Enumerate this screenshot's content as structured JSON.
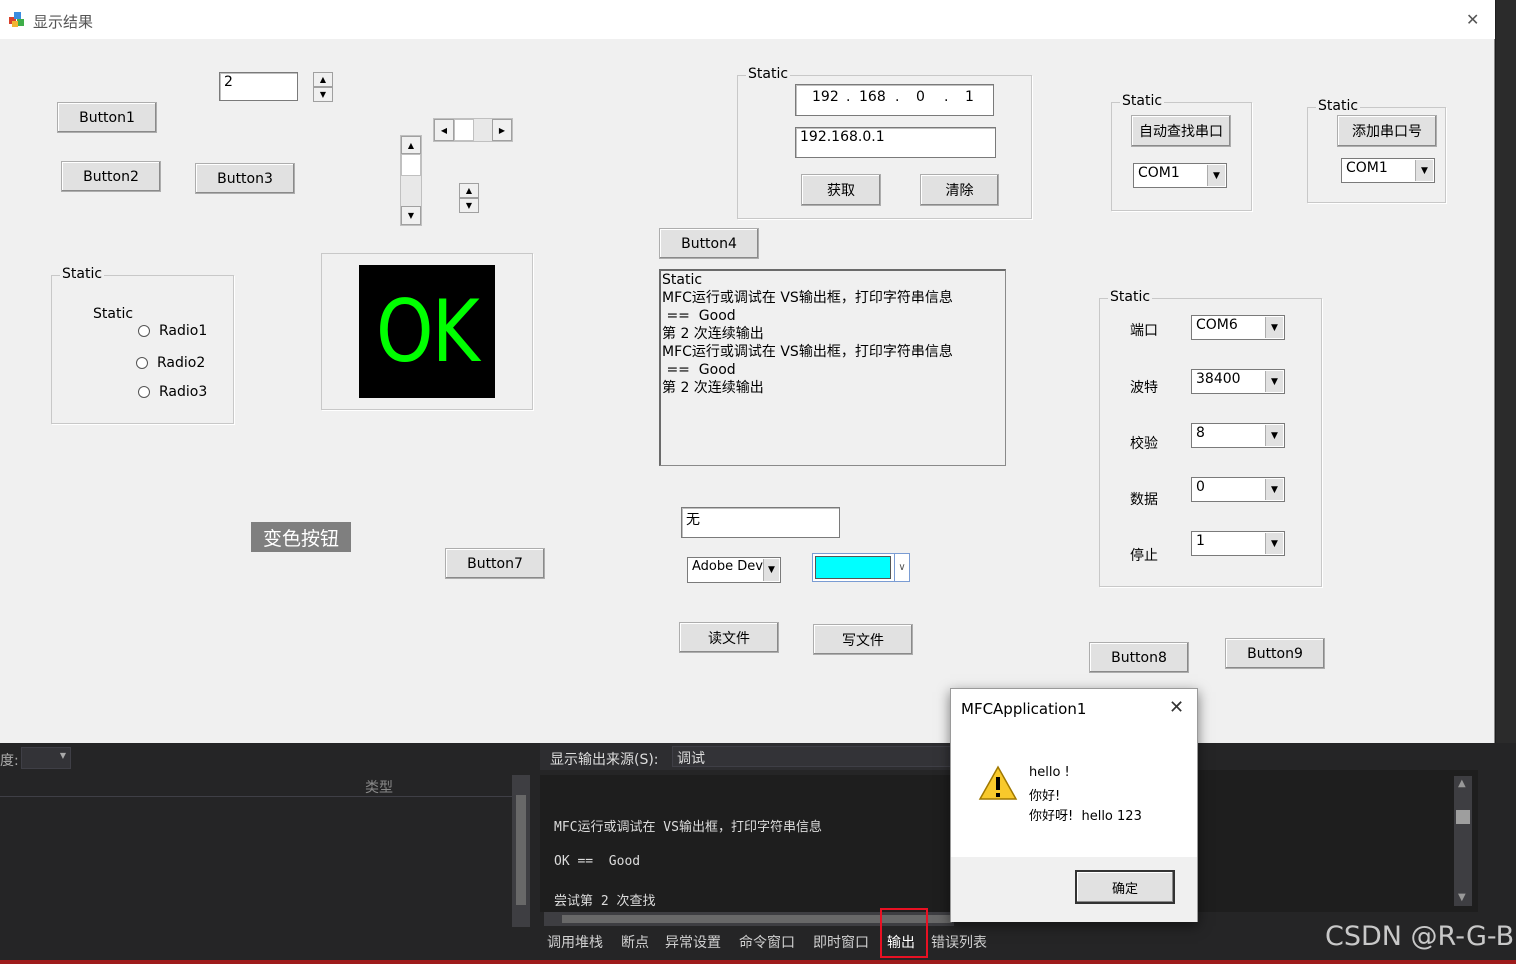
{
  "dialog": {
    "title": "显示结果",
    "close": "✕",
    "buttons": {
      "b1": "Button1",
      "b2": "Button2",
      "b3": "Button3",
      "b4": "Button4",
      "b7": "Button7",
      "b8": "Button8",
      "b9": "Button9",
      "color_btn": "变色按钮",
      "read_file": "读文件",
      "write_file": "写文件"
    },
    "spin_value": "2",
    "radio_group": {
      "caption": "Static",
      "inner_label": "Static",
      "radios": [
        "Radio1",
        "Radio2",
        "Radio3"
      ]
    },
    "ok_display": {
      "text": "OK",
      "color": "#00ff00",
      "bg": "#000000"
    },
    "ip_group": {
      "caption": "Static",
      "octets": [
        "192",
        "168",
        "0",
        "1"
      ],
      "ip_text": "192.168.0.1",
      "get_btn": "获取",
      "clear_btn": "清除"
    },
    "serial_find": {
      "caption": "Static",
      "btn": "自动查找串口",
      "combo": "COM1"
    },
    "serial_add": {
      "caption": "Static",
      "btn": "添加串口号",
      "combo": "COM1"
    },
    "log_box": {
      "lines": [
        "Static",
        "MFC运行或调试在 VS输出框，打印字符串信息",
        " ==  Good",
        "第 2 次连续输出",
        "MFC运行或调试在 VS输出框，打印字符串信息",
        " ==  Good",
        "第 2 次连续输出"
      ]
    },
    "serial_cfg": {
      "caption": "Static",
      "rows": [
        {
          "label": "端口",
          "value": "COM6"
        },
        {
          "label": "波特",
          "value": "38400"
        },
        {
          "label": "校验",
          "value": "8"
        },
        {
          "label": "数据",
          "value": "0"
        },
        {
          "label": "停止",
          "value": "1"
        }
      ]
    },
    "none_edit": "无",
    "font_combo": "Adobe Dev",
    "color_swatch": "#00ffff"
  },
  "ide": {
    "left_label": "度:",
    "type_header": "类型",
    "source_label": "显示输出来源(S):",
    "source_value": "调试",
    "output_lines": [
      "MFC运行或调试在 VS输出框，打印字符串信息",
      "OK ==  Good",
      "尝试第 2 次查找"
    ],
    "tabs": [
      "调用堆栈",
      "断点",
      "异常设置",
      "命令窗口",
      "即时窗口",
      "输出",
      "错误列表"
    ],
    "active_tab": "输出",
    "watermark": "CSDN @R-G-B"
  },
  "msgbox": {
    "title": "MFCApplication1",
    "lines": [
      "hello !",
      "你好!",
      "你好呀!  hello 123"
    ],
    "ok": "确定"
  }
}
